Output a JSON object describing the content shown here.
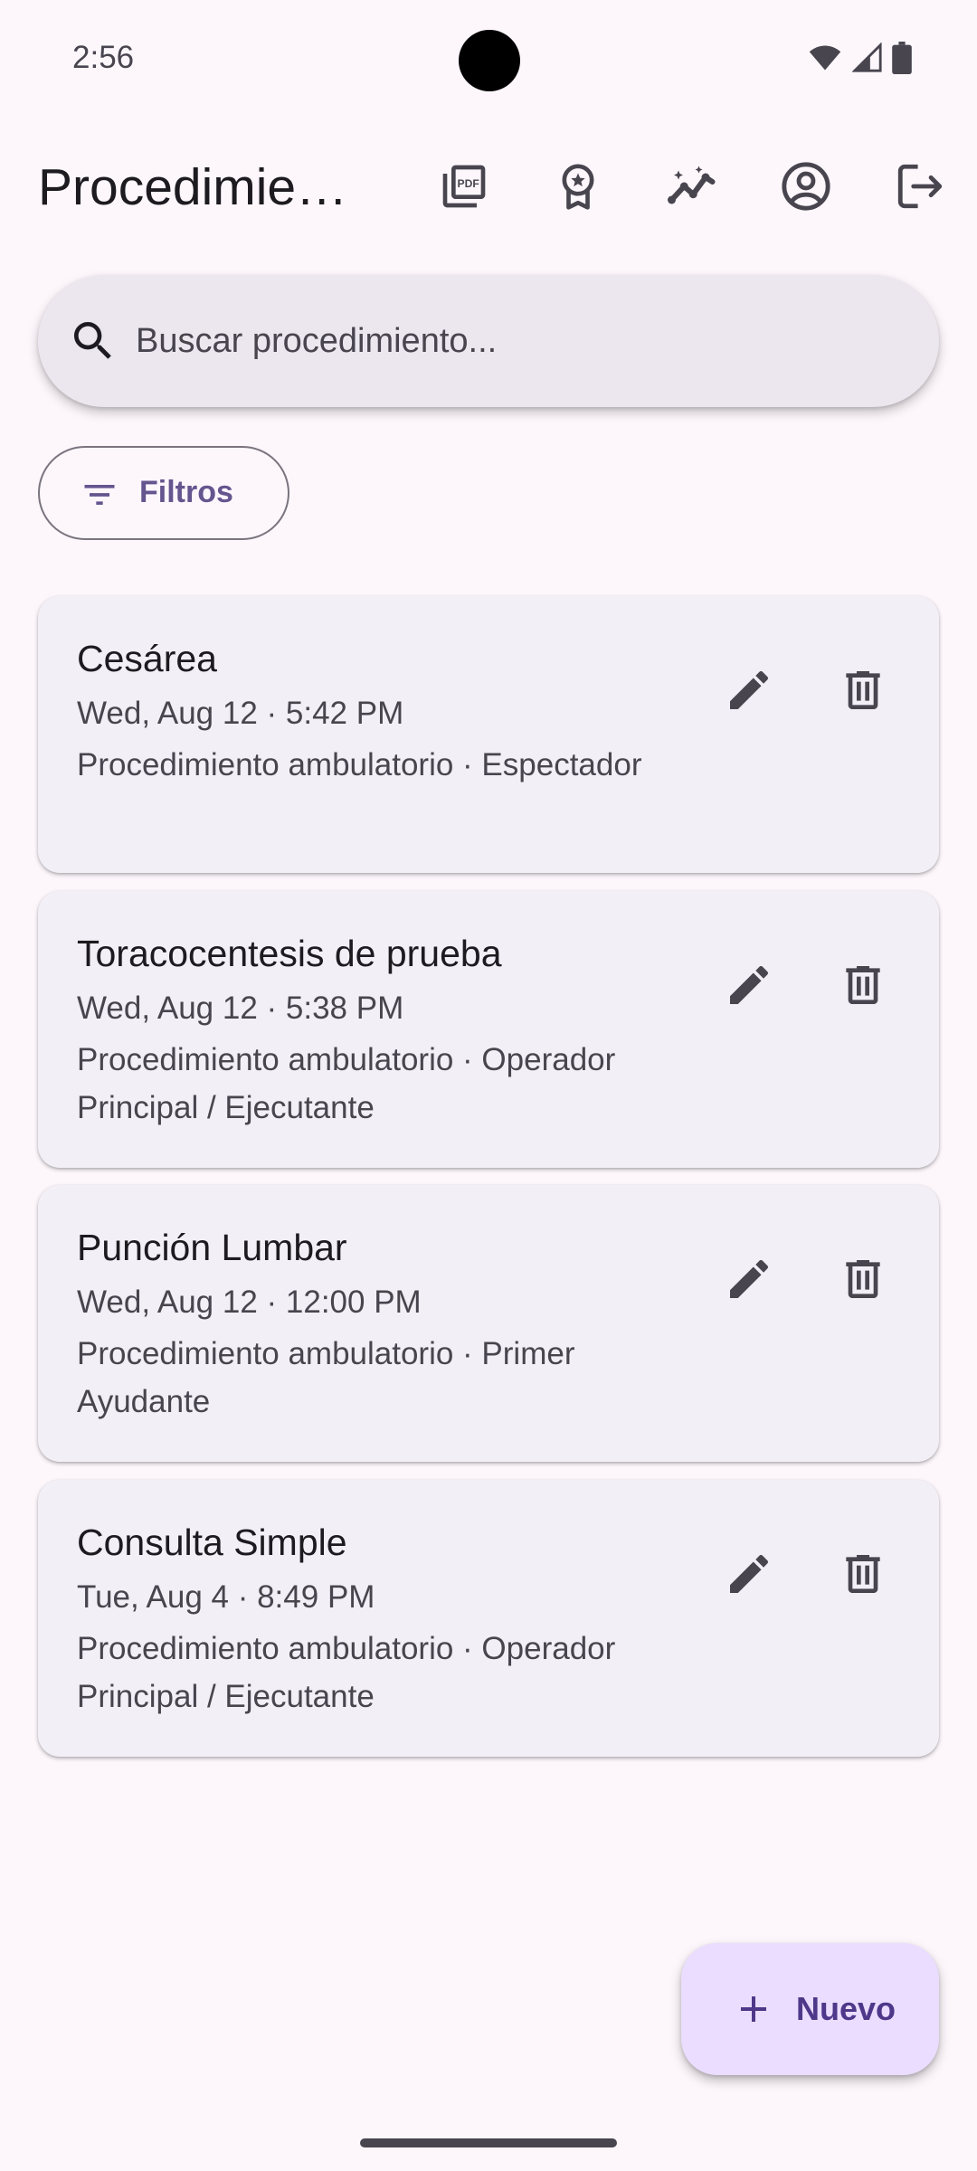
{
  "status_bar": {
    "time": "2:56",
    "icons": [
      "wifi-icon",
      "cell-signal-icon",
      "battery-icon"
    ]
  },
  "app_bar": {
    "title": "Procedimientos",
    "actions": [
      "pdf-icon",
      "award-icon",
      "stats-icon",
      "account-icon",
      "logout-icon"
    ]
  },
  "search": {
    "placeholder": "Buscar procedimiento...",
    "value": ""
  },
  "filter_chip": {
    "label": "Filtros"
  },
  "procedures": [
    {
      "title": "Cesárea",
      "date": "Wed, Aug 12 · 5:42 PM",
      "detail": "Procedimiento ambulatorio · Espectador"
    },
    {
      "title": "Toracocentesis de prueba",
      "date": "Wed, Aug 12 · 5:38 PM",
      "detail": "Procedimiento ambulatorio · Operador Principal / Ejecutante"
    },
    {
      "title": "Punción Lumbar",
      "date": "Wed, Aug 12 · 12:00 PM",
      "detail": "Procedimiento ambulatorio · Primer Ayudante"
    },
    {
      "title": "Consulta Simple",
      "date": "Tue, Aug 4 · 8:49 PM",
      "detail": "Procedimiento ambulatorio · Operador Principal / Ejecutante"
    }
  ],
  "fab": {
    "label": "Nuevo"
  },
  "colors": {
    "background": "#fdf7fc",
    "surface_card": "#f3eff6",
    "search_bar": "#ece6ef",
    "primary": "#65558f",
    "fab_container": "#eaddff",
    "fab_content": "#4f378a",
    "on_surface": "#1d1b20",
    "on_surface_variant": "#49454f"
  }
}
